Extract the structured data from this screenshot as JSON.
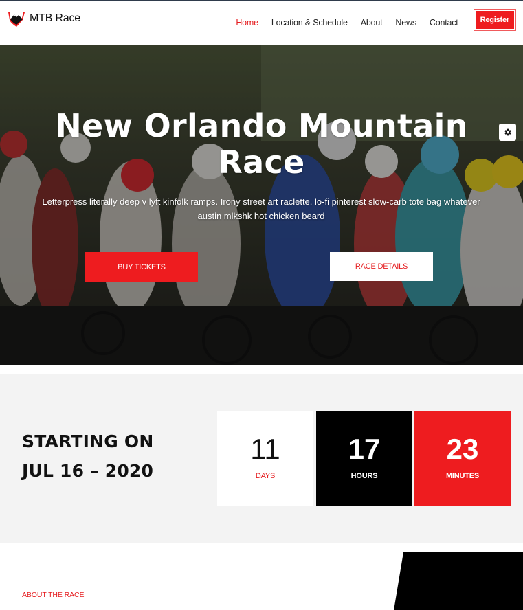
{
  "header": {
    "brand": "MTB Race",
    "logo_icon": "mountain-logo-icon",
    "nav": [
      {
        "label": "Home",
        "active": true
      },
      {
        "label": "Location & Schedule",
        "active": false
      },
      {
        "label": "About",
        "active": false
      },
      {
        "label": "News",
        "active": false
      },
      {
        "label": "Contact",
        "active": false
      }
    ],
    "register_label": "Register"
  },
  "hero": {
    "title_line1": "New Orlando Mountain",
    "title_line2": "Race",
    "text_line1": "Letterpress literally deep v lyft kinfolk ramps. Irony street art raclette, lo-fi pinterest slow-carb tote bag whatever",
    "text_line2": "austin mlkshk hot chicken beard",
    "buy_label": "BUY TICKETS",
    "details_label": "RACE DETAILS",
    "settings_icon": "gear-icon"
  },
  "countdown": {
    "heading_line1": "STARTING ON",
    "heading_line2": "JUL 16 – 2020",
    "days": {
      "value": "11",
      "label": "DAYS"
    },
    "hours": {
      "value": "17",
      "label": "HOURS"
    },
    "minutes": {
      "value": "23",
      "label": "MINUTES"
    }
  },
  "about": {
    "label": "ABOUT THE RACE"
  },
  "colors": {
    "accent": "#ee1c1f",
    "dark": "#000000",
    "section_bg": "#f3f3f3"
  }
}
